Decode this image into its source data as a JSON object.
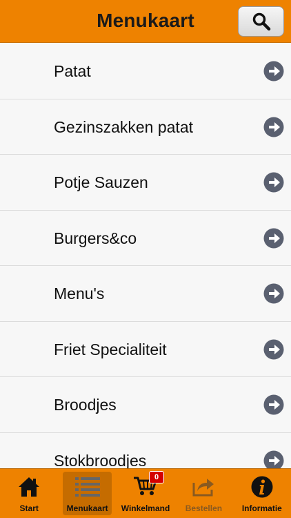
{
  "header": {
    "title": "Menukaart"
  },
  "menu": {
    "items": [
      {
        "label": "Patat"
      },
      {
        "label": "Gezinszakken patat"
      },
      {
        "label": "Potje Sauzen"
      },
      {
        "label": "Burgers&co"
      },
      {
        "label": "Menu's"
      },
      {
        "label": "Friet Specialiteit"
      },
      {
        "label": "Broodjes"
      },
      {
        "label": "Stokbroodjes"
      }
    ]
  },
  "tabbar": {
    "tabs": [
      {
        "label": "Start",
        "icon": "home-icon"
      },
      {
        "label": "Menukaart",
        "icon": "list-icon",
        "active": true
      },
      {
        "label": "Winkelmand",
        "icon": "cart-icon",
        "badge": "0"
      },
      {
        "label": "Bestellen",
        "icon": "share-icon",
        "disabled": true
      },
      {
        "label": "Informatie",
        "icon": "info-icon"
      }
    ]
  },
  "colors": {
    "accent": "#ee8200",
    "active_tab": "#c56c00",
    "badge": "#d40000",
    "arrow": "#5a6070"
  }
}
